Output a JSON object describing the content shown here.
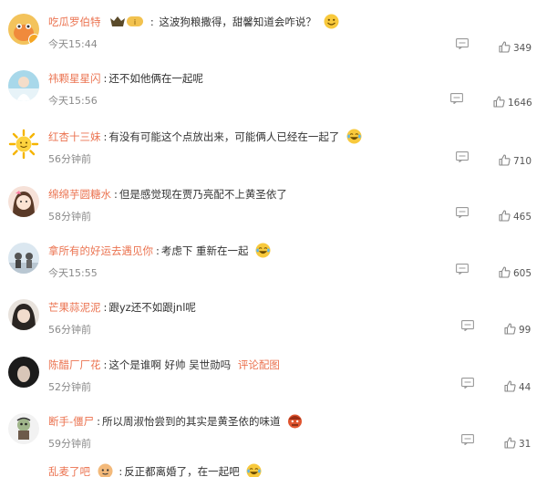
{
  "comments": [
    {
      "user": "吃瓜罗伯特",
      "text": "这波狗粮撒得，甜馨知道会咋说？",
      "time": "今天15:44",
      "likes": "349"
    },
    {
      "user": "祎颗星星闪",
      "text": "还不如他俩在一起呢",
      "time": "今天15:56",
      "likes": "1646"
    },
    {
      "user": "红杏十三妹",
      "text": "有没有可能这个点放出来，可能俩人已经在一起了",
      "time": "56分钟前",
      "likes": "710"
    },
    {
      "user": "绵绵芋圆糖水",
      "text": "但是感觉现在贾乃亮配不上黄圣依了",
      "time": "58分钟前",
      "likes": "465"
    },
    {
      "user": "拿所有的好运去遇见你",
      "text": "考虑下 重新在一起",
      "time": "今天15:55",
      "likes": "605"
    },
    {
      "user": "芒果蒜泥泥",
      "text": "跟yz还不如跟jnl呢",
      "time": "56分钟前",
      "likes": "99"
    },
    {
      "user": "陈醋厂厂花",
      "text": "这个是谁啊 好帅 吴世勋吗",
      "link": "评论配图",
      "time": "52分钟前",
      "likes": "44"
    },
    {
      "user": "断手-僵尸",
      "text": "所以周淑怡尝到的其实是黄圣依的味道",
      "time": "59分钟前",
      "likes": "31"
    },
    {
      "user": "乱麦了吧",
      "text": "反正都离婚了，在一起吧",
      "time": "",
      "likes": ""
    }
  ],
  "icons": {
    "reply": "comment-bubble-icon",
    "like": "thumbs-up-icon"
  },
  "colors": {
    "username": "#eb7350",
    "text": "#333333",
    "meta": "#8a8a8a",
    "icon": "#999999"
  }
}
